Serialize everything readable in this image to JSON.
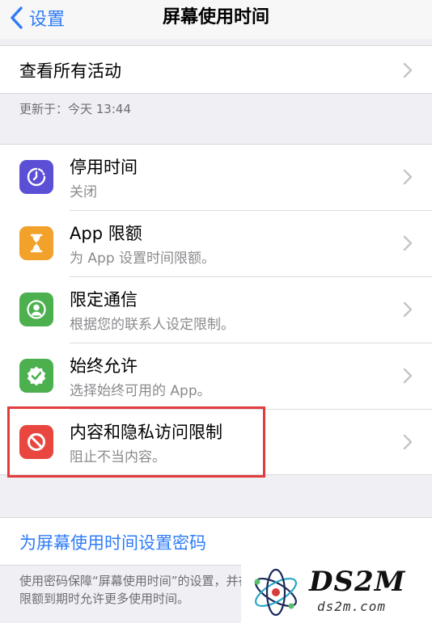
{
  "nav": {
    "back_label": "设置",
    "title": "屏幕使用时间"
  },
  "activity": {
    "label": "查看所有活动",
    "updated": "更新于：今天 13:44"
  },
  "features": [
    {
      "title": "停用时间",
      "subtitle": "关闭",
      "icon": "downtime-icon",
      "color": "#5b4fd6"
    },
    {
      "title": "App 限额",
      "subtitle": "为 App 设置时间限额。",
      "icon": "hourglass-icon",
      "color": "#f2a12b"
    },
    {
      "title": "限定通信",
      "subtitle": "根据您的联系人设定限制。",
      "icon": "contact-icon",
      "color": "#4cb04f"
    },
    {
      "title": "始终允许",
      "subtitle": "选择始终可用的 App。",
      "icon": "checkmark-badge-icon",
      "color": "#4cb04f"
    },
    {
      "title": "内容和隐私访问限制",
      "subtitle": "阻止不当内容。",
      "icon": "prohibited-icon",
      "color": "#e8463f"
    }
  ],
  "passcode": {
    "label": "为屏幕使用时间设置密码"
  },
  "footnote": "使用密码保障“屏幕使用时间”的设置，并在限额到期时允许更多使用时间。",
  "watermark": {
    "brand": "DS2M",
    "url": "ds2m.com"
  },
  "colors": {
    "accent": "#2f7cf6",
    "highlight": "#e23b3b"
  }
}
